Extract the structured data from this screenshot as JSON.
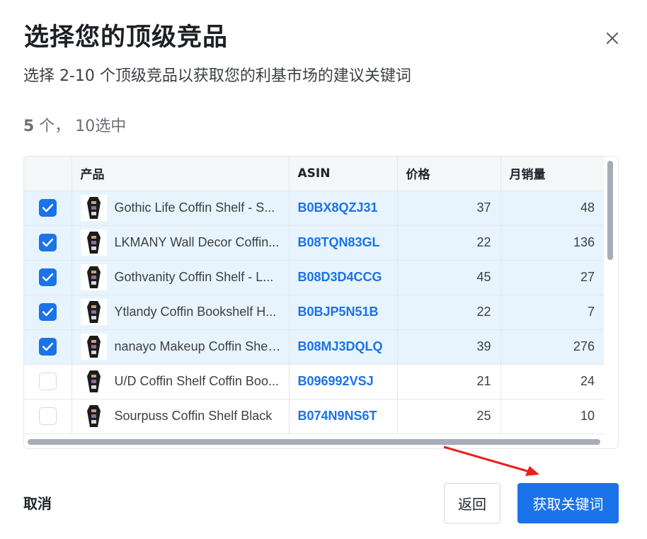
{
  "dialog": {
    "title": "选择您的顶级竞品",
    "subtitle": "选择 2-10 个顶级竞品以获取您的利基市场的建议关键词",
    "count_num": "5",
    "count_text": " 个， 10选中"
  },
  "table": {
    "headers": {
      "product": "产品",
      "asin": "ASIN",
      "price": "价格",
      "sales": "月销量"
    },
    "rows": [
      {
        "selected": true,
        "product": "Gothic Life Coffin Shelf - S...",
        "asin": "B0BX8QZJ31",
        "price": "37",
        "sales": "48"
      },
      {
        "selected": true,
        "product": "LKMANY Wall Decor Coffin...",
        "asin": "B08TQN83GL",
        "price": "22",
        "sales": "136"
      },
      {
        "selected": true,
        "product": "Gothvanity Coffin Shelf - L...",
        "asin": "B08D3D4CCG",
        "price": "45",
        "sales": "27"
      },
      {
        "selected": true,
        "product": "Ytlandy Coffin Bookshelf H...",
        "asin": "B0BJP5N51B",
        "price": "22",
        "sales": "7"
      },
      {
        "selected": true,
        "product": "nanayo Makeup Coffin Shel...",
        "asin": "B08MJ3DQLQ",
        "price": "39",
        "sales": "276"
      },
      {
        "selected": false,
        "product": "U/D Coffin Shelf Coffin Boo...",
        "asin": "B096992VSJ",
        "price": "21",
        "sales": "24"
      },
      {
        "selected": false,
        "product": "Sourpuss Coffin Shelf Black",
        "asin": "B074N9NS6T",
        "price": "25",
        "sales": "10"
      }
    ]
  },
  "footer": {
    "cancel": "取消",
    "back": "返回",
    "primary": "获取关键词"
  },
  "colors": {
    "accent": "#1a73e8",
    "selected_row": "#e8f4fd",
    "annotation_arrow": "#e8201e"
  },
  "icons": {
    "close": "close-icon",
    "check": "check-icon",
    "thumbnail": "coffin-shelf-icon"
  }
}
